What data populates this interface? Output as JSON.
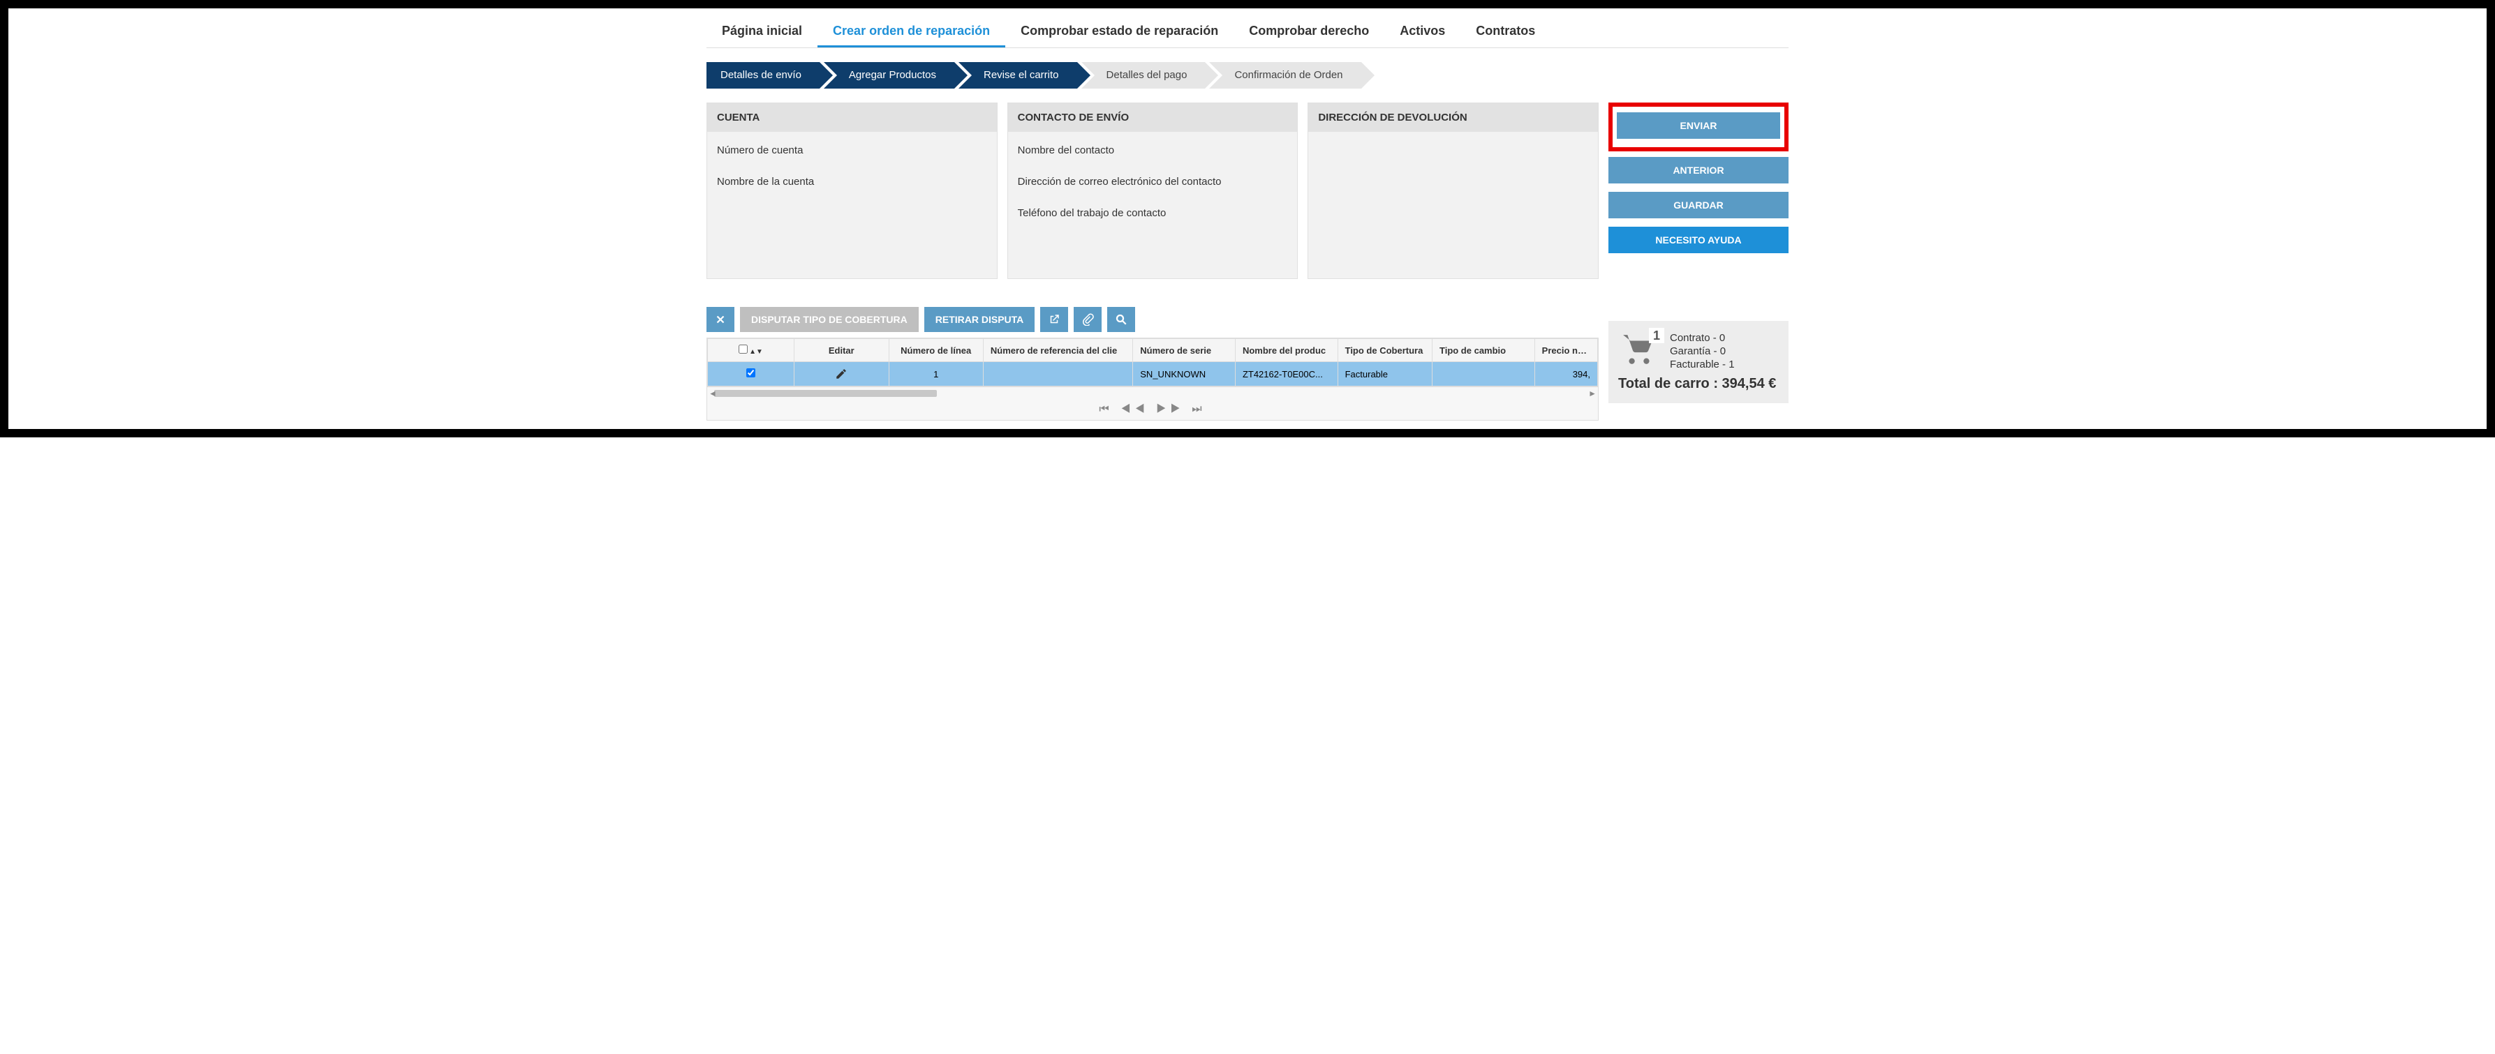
{
  "nav": {
    "items": [
      "Página inicial",
      "Crear orden de reparación",
      "Comprobar estado de reparación",
      "Comprobar derecho",
      "Activos",
      "Contratos"
    ],
    "active_index": 1
  },
  "steps": {
    "items": [
      "Detalles de envío",
      "Agregar Productos",
      "Revise el carrito",
      "Detalles del pago",
      "Confirmación de Orden"
    ],
    "active_upto": 3
  },
  "panels": {
    "cuenta": {
      "title": "CUENTA",
      "fields": [
        "Número de cuenta",
        "Nombre de la cuenta"
      ]
    },
    "contacto": {
      "title": "CONTACTO DE ENVÍO",
      "fields": [
        "Nombre del contacto",
        "Dirección de correo electrónico del contacto",
        "Teléfono del trabajo de contacto"
      ]
    },
    "direccion": {
      "title": "DIRECCIÓN DE DEVOLUCIÓN",
      "fields": []
    }
  },
  "buttons": {
    "enviar": "ENVIAR",
    "anterior": "ANTERIOR",
    "guardar": "GUARDAR",
    "ayuda": "NECESITO AYUDA"
  },
  "toolbar": {
    "disputar": "DISPUTAR TIPO DE COBERTURA",
    "retirar": "RETIRAR DISPUTA"
  },
  "table": {
    "headers": [
      "",
      "Editar",
      "Número de línea",
      "Número de referencia del clie",
      "Número de serie",
      "Nombre del produc",
      "Tipo de Cobertura",
      "Tipo de cambio",
      "Precio neto"
    ],
    "rows": [
      {
        "checked": true,
        "linea": "1",
        "ref": "",
        "serie": "SN_UNKNOWN",
        "producto": "ZT42162-T0E00C...",
        "cobertura": "Facturable",
        "cambio": "",
        "precio": "394,"
      }
    ]
  },
  "cart": {
    "badge": "1",
    "lines": [
      "Contrato - 0",
      "Garantía - 0",
      "Facturable - 1"
    ],
    "total": "Total de carro : 394,54 €"
  }
}
